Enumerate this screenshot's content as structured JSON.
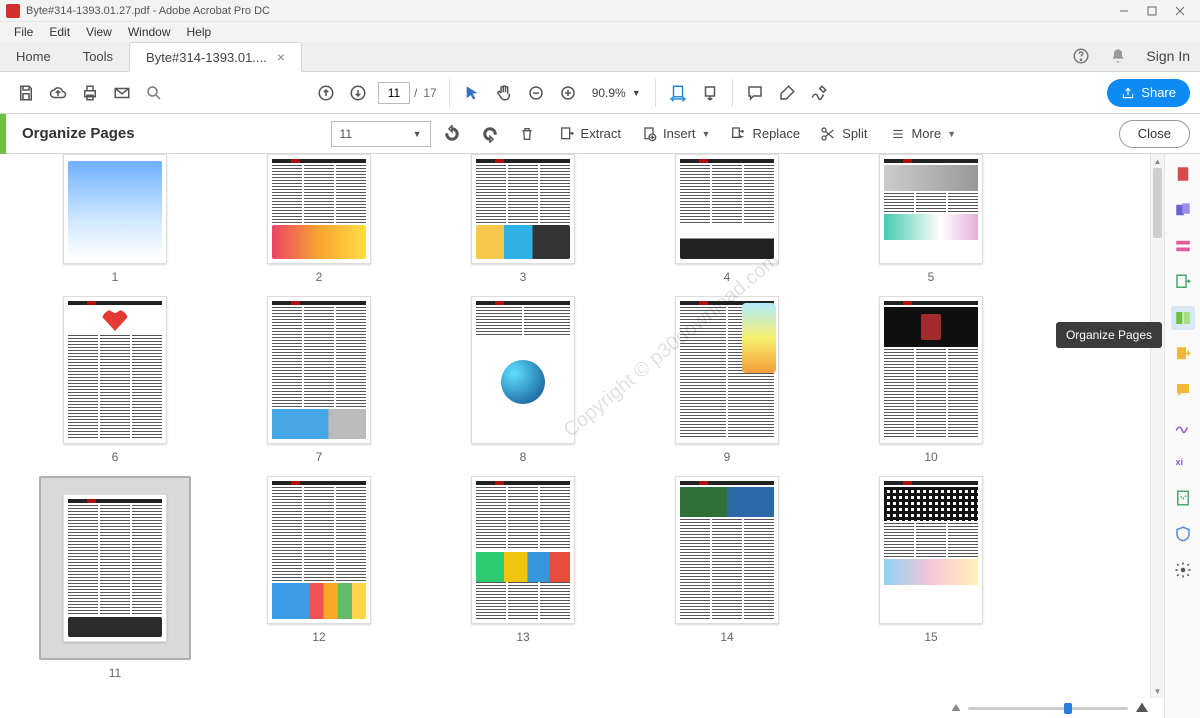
{
  "titlebar": {
    "text": "Byte#314-1393.01.27.pdf - Adobe Acrobat Pro DC"
  },
  "menubar": [
    "File",
    "Edit",
    "View",
    "Window",
    "Help"
  ],
  "tabs": {
    "home": "Home",
    "tools": "Tools",
    "file": "Byte#314-1393.01....",
    "signin": "Sign In"
  },
  "maintb": {
    "page_current": "11",
    "page_total": "17",
    "page_sep": "/",
    "zoom": "90.9%",
    "share": "Share"
  },
  "subtb": {
    "title": "Organize Pages",
    "page_dropdown": "11",
    "extract": "Extract",
    "insert": "Insert",
    "replace": "Replace",
    "split": "Split",
    "more": "More",
    "close": "Close"
  },
  "tooltip": "Organize Pages",
  "watermark": "Copyright © p30download.com",
  "pages": [
    "1",
    "2",
    "3",
    "4",
    "5",
    "6",
    "7",
    "8",
    "9",
    "10",
    "11",
    "12",
    "13",
    "14",
    "15"
  ],
  "selected_page": 11
}
